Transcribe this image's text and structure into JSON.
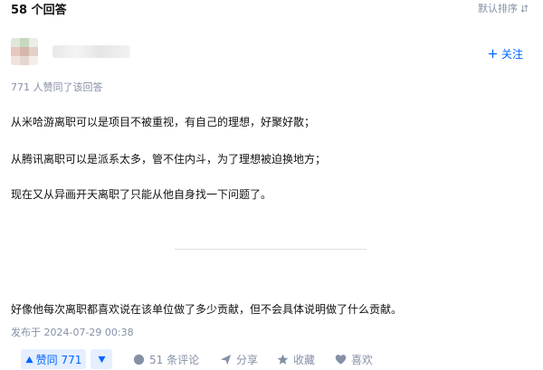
{
  "header": {
    "answer_count": "58 个回答",
    "sort_label": "默认排序"
  },
  "author": {
    "follow_label": "关注"
  },
  "upvote_info": "771 人赞同了该回答",
  "content": {
    "paragraphs": [
      "从米哈游离职可以是项目不被重视，有自己的理想，好聚好散；",
      "从腾讯离职可以是派系太多，管不住内斗，为了理想被迫换地方；",
      "现在又从异画开天离职了只能从他自身找一下问题了。",
      "好像他每次离职都喜欢说在该单位做了多少贡献，但不会具体说明做了什么贡献。"
    ]
  },
  "publish_info": "发布于 2024-07-29 00:38",
  "actions": {
    "upvote_label": "赞同 771",
    "comments_label": "51 条评论",
    "share_label": "分享",
    "favorite_label": "收藏",
    "like_label": "喜欢"
  },
  "colors": {
    "accent": "#0066ff",
    "accent_bg": "#e5efff",
    "meta": "#8590a6",
    "text": "#121212"
  }
}
